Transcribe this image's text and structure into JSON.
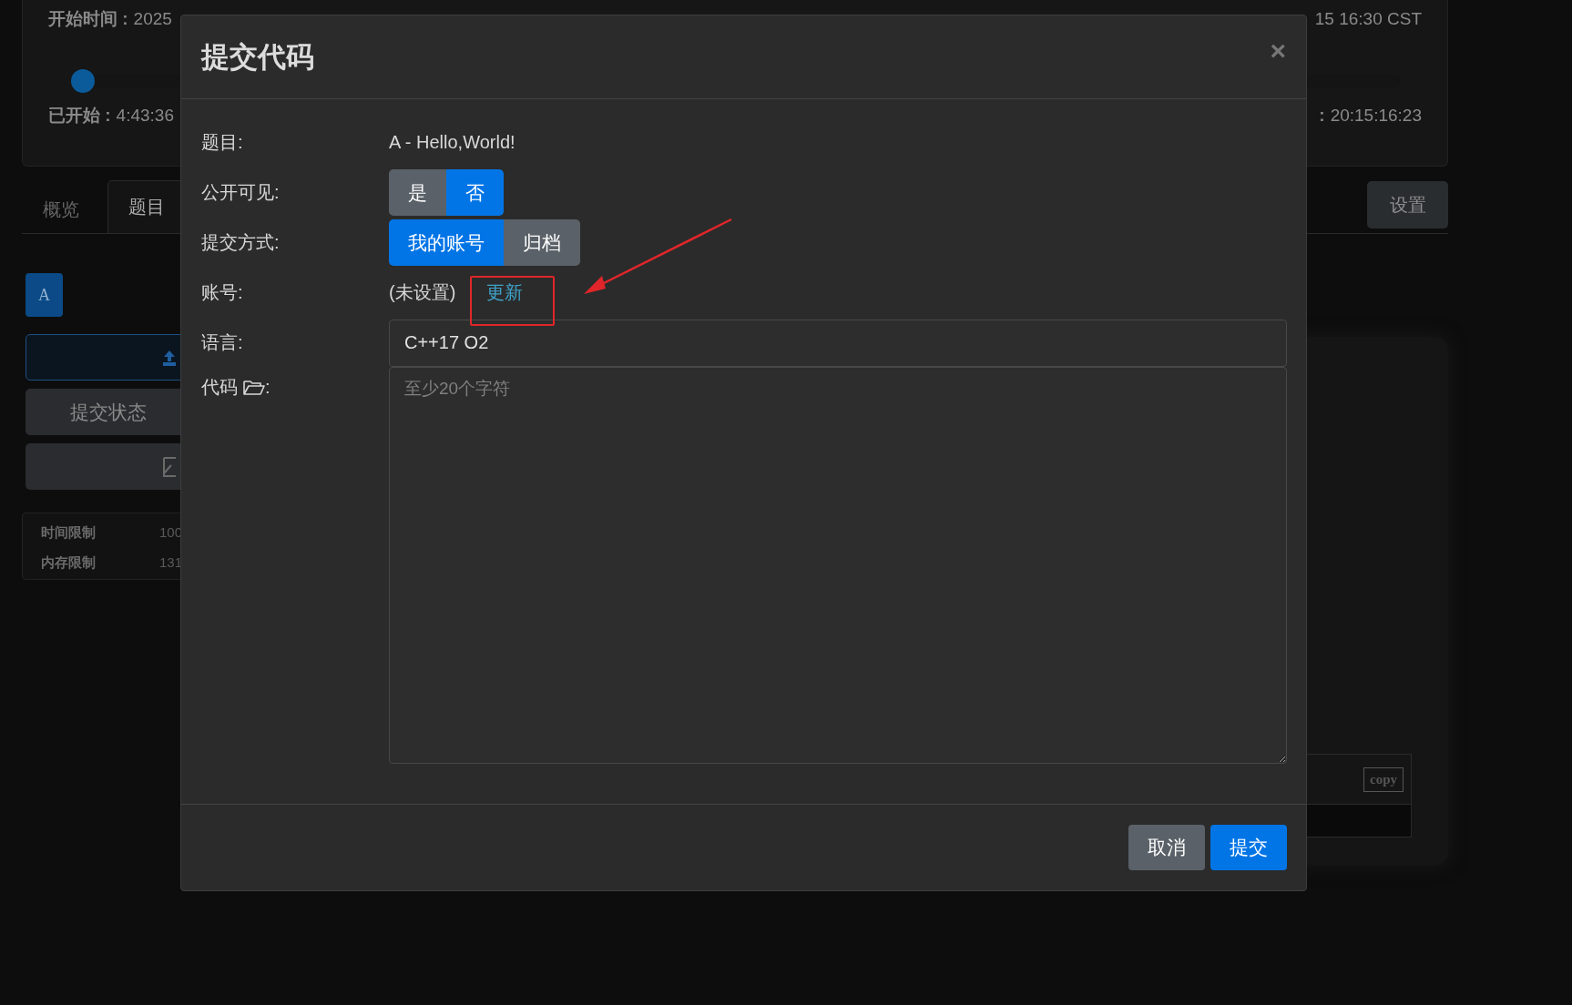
{
  "contest_header": {
    "start_label": "开始时间 :",
    "start_value": "2025",
    "end_value": "15 16:30 CST",
    "elapsed_label": "已开始 :",
    "elapsed_value": "4:43:36",
    "remaining_label": ":",
    "remaining_value": "20:15:16:23",
    "progress": {
      "level": 0.008
    }
  },
  "tabs": [
    {
      "label": "概览",
      "selected": false
    },
    {
      "label": "题目",
      "selected": true
    }
  ],
  "settings_button": "设置",
  "sidebar": {
    "problem_badge": "A",
    "status_button": "提交状态",
    "limits": [
      {
        "label": "时间限制",
        "value": "100"
      },
      {
        "label": "内存限制",
        "value": "131"
      }
    ]
  },
  "sample": {
    "copy_button": "copy"
  },
  "modal": {
    "title": "提交代码",
    "close": "×",
    "problem_label": "题目:",
    "problem_value": "A - Hello,World!",
    "visibility_label": "公开可见:",
    "visibility_options": [
      {
        "label": "是",
        "selected": false
      },
      {
        "label": "否",
        "selected": true
      }
    ],
    "method_label": "提交方式:",
    "method_options": [
      {
        "label": "我的账号",
        "selected": true
      },
      {
        "label": "归档",
        "selected": false
      }
    ],
    "account_label": "账号:",
    "account_value": "(未设置)",
    "account_link": "更新",
    "language_label": "语言:",
    "language_value": "C++17 O2",
    "code_label": "代码",
    "code_colon": ":",
    "code_placeholder": "至少20个字符",
    "buttons": [
      {
        "label": "取消",
        "kind": "secondary"
      },
      {
        "label": "提交",
        "kind": "primary"
      }
    ]
  }
}
